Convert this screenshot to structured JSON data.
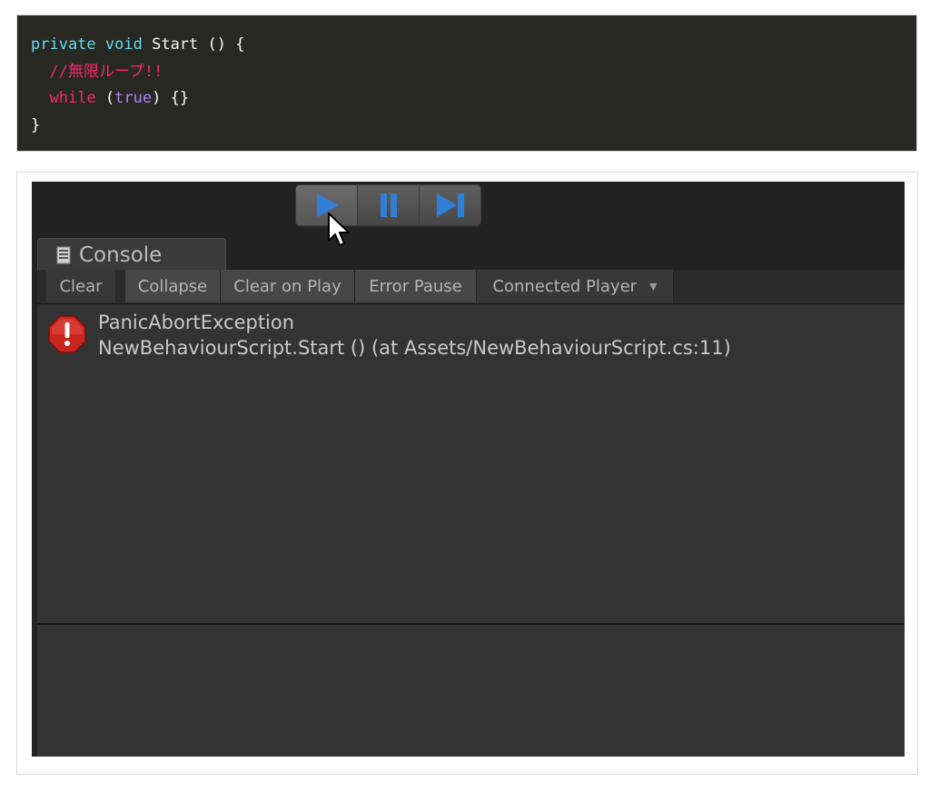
{
  "code": {
    "lines": [
      [
        {
          "cls": "tok-kw",
          "text": "private"
        },
        {
          "cls": "tok-plain",
          "text": " "
        },
        {
          "cls": "tok-kw",
          "text": "void"
        },
        {
          "cls": "tok-plain",
          "text": " Start () {"
        }
      ],
      [
        {
          "cls": "tok-plain",
          "text": "  "
        },
        {
          "cls": "tok-comment",
          "text": "//無限ループ!!"
        }
      ],
      [
        {
          "cls": "tok-plain",
          "text": "  "
        },
        {
          "cls": "tok-ctrl",
          "text": "while"
        },
        {
          "cls": "tok-plain",
          "text": " ("
        },
        {
          "cls": "tok-bool",
          "text": "true"
        },
        {
          "cls": "tok-plain",
          "text": ") {}"
        }
      ],
      [
        {
          "cls": "tok-plain",
          "text": "}"
        }
      ]
    ]
  },
  "play_controls": {
    "play_icon": "play-icon",
    "pause_icon": "pause-icon",
    "step_icon": "step-icon",
    "accent": "#2f7fd6"
  },
  "console": {
    "tab_label": "Console",
    "tab_icon": "console-icon",
    "toolbar": {
      "clear": "Clear",
      "collapse": "Collapse",
      "clear_on_play": "Clear on Play",
      "error_pause": "Error Pause",
      "connected_player": "Connected Player"
    },
    "entries": [
      {
        "icon": "error-icon",
        "title": "PanicAbortException",
        "detail": "NewBehaviourScript.Start () (at Assets/NewBehaviourScript.cs:11)"
      }
    ]
  }
}
